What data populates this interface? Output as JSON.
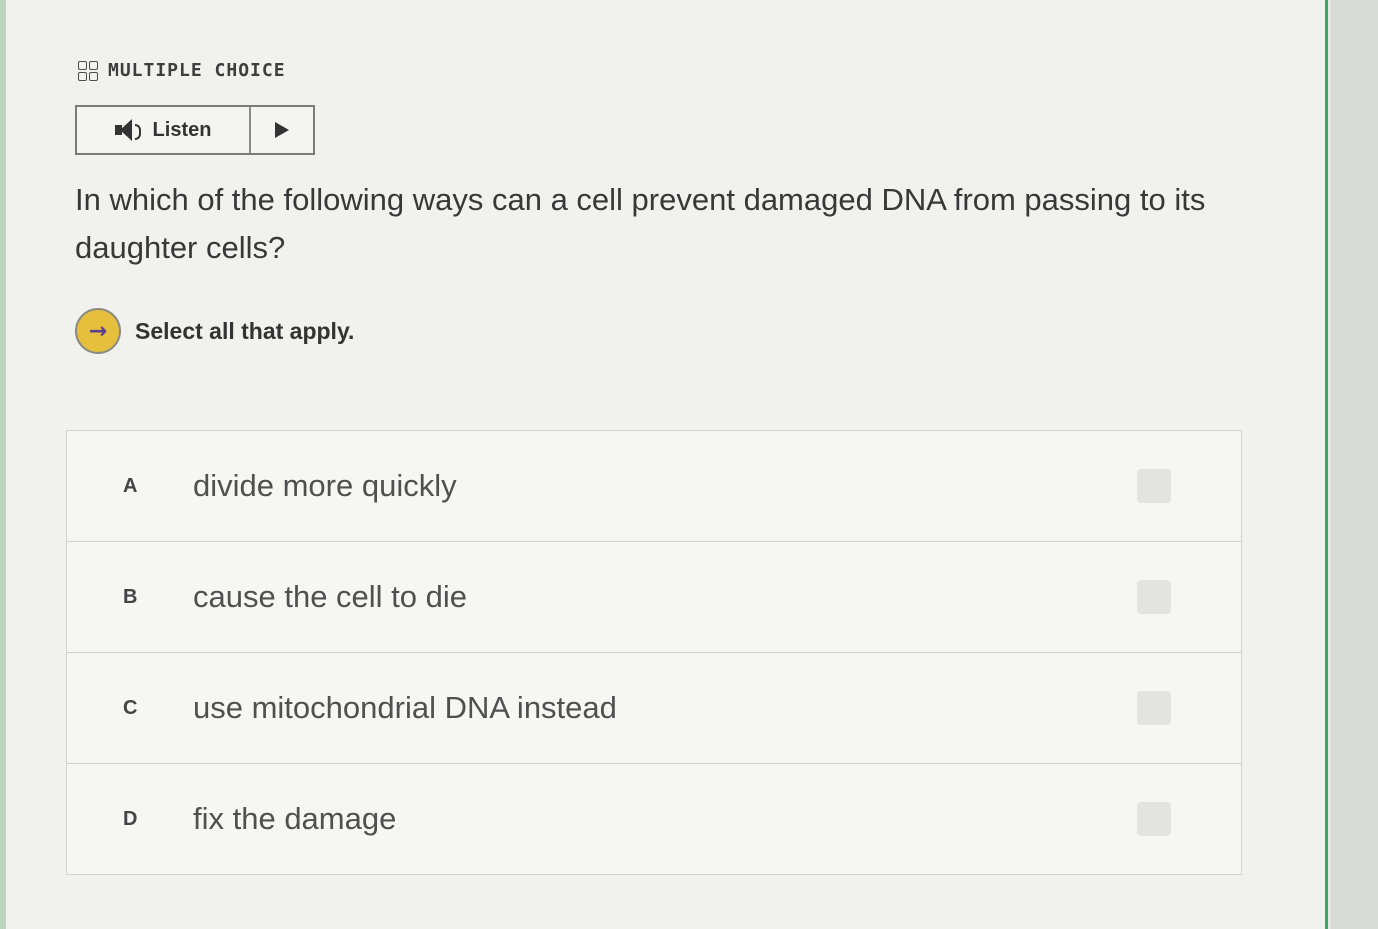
{
  "header": {
    "icon": "grid-icon",
    "title": "MULTIPLE CHOICE"
  },
  "listen": {
    "label": "Listen",
    "speaker_icon": "speaker-icon",
    "play_icon": "play-icon"
  },
  "question": {
    "text": "In which of the following ways can a cell prevent damaged DNA from passing to its daughter cells?"
  },
  "instruction": {
    "icon": "arrow-right-icon",
    "icon_glyph": "→",
    "text": "Select all that apply."
  },
  "choices": [
    {
      "letter": "A",
      "text": "divide more quickly",
      "checked": false
    },
    {
      "letter": "B",
      "text": "cause the cell to die",
      "checked": false
    },
    {
      "letter": "C",
      "text": "use mitochondrial DNA instead",
      "checked": false
    },
    {
      "letter": "D",
      "text": "fix the damage",
      "checked": false
    }
  ],
  "colors": {
    "accent_green": "#3aa66a",
    "instruction_circle": "#e6bf3c"
  }
}
